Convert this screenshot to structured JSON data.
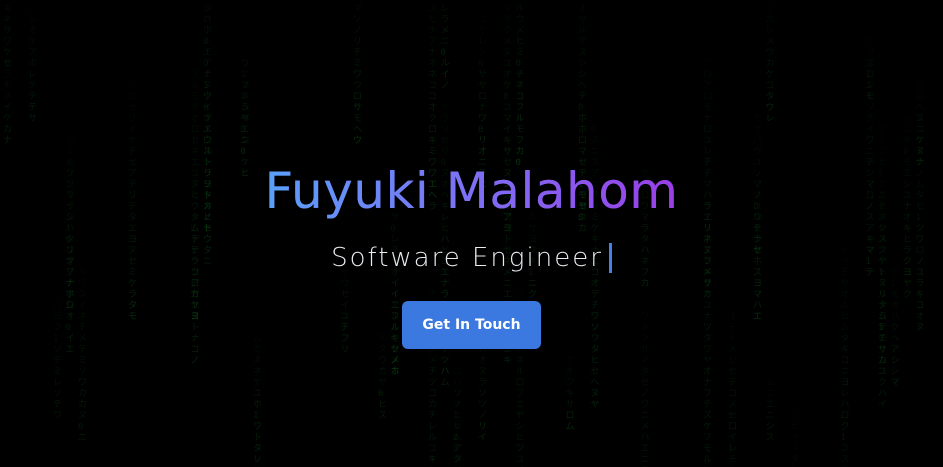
{
  "hero": {
    "name": "Fuyuki Malahom",
    "subtitle": "Software Engineer",
    "cta_label": "Get In Touch"
  },
  "background": {
    "style": "matrix-rain",
    "glyph_color": "#1fbf3a",
    "base_color": "#000000"
  },
  "colors": {
    "name_gradient_start": "#5a9cf8",
    "name_gradient_end": "#9a3fe6",
    "cursor": "#4a7ee8",
    "cta_background": "#3b78e0",
    "cta_text": "#ffffff",
    "subtitle_text": "#e9ecf2"
  }
}
